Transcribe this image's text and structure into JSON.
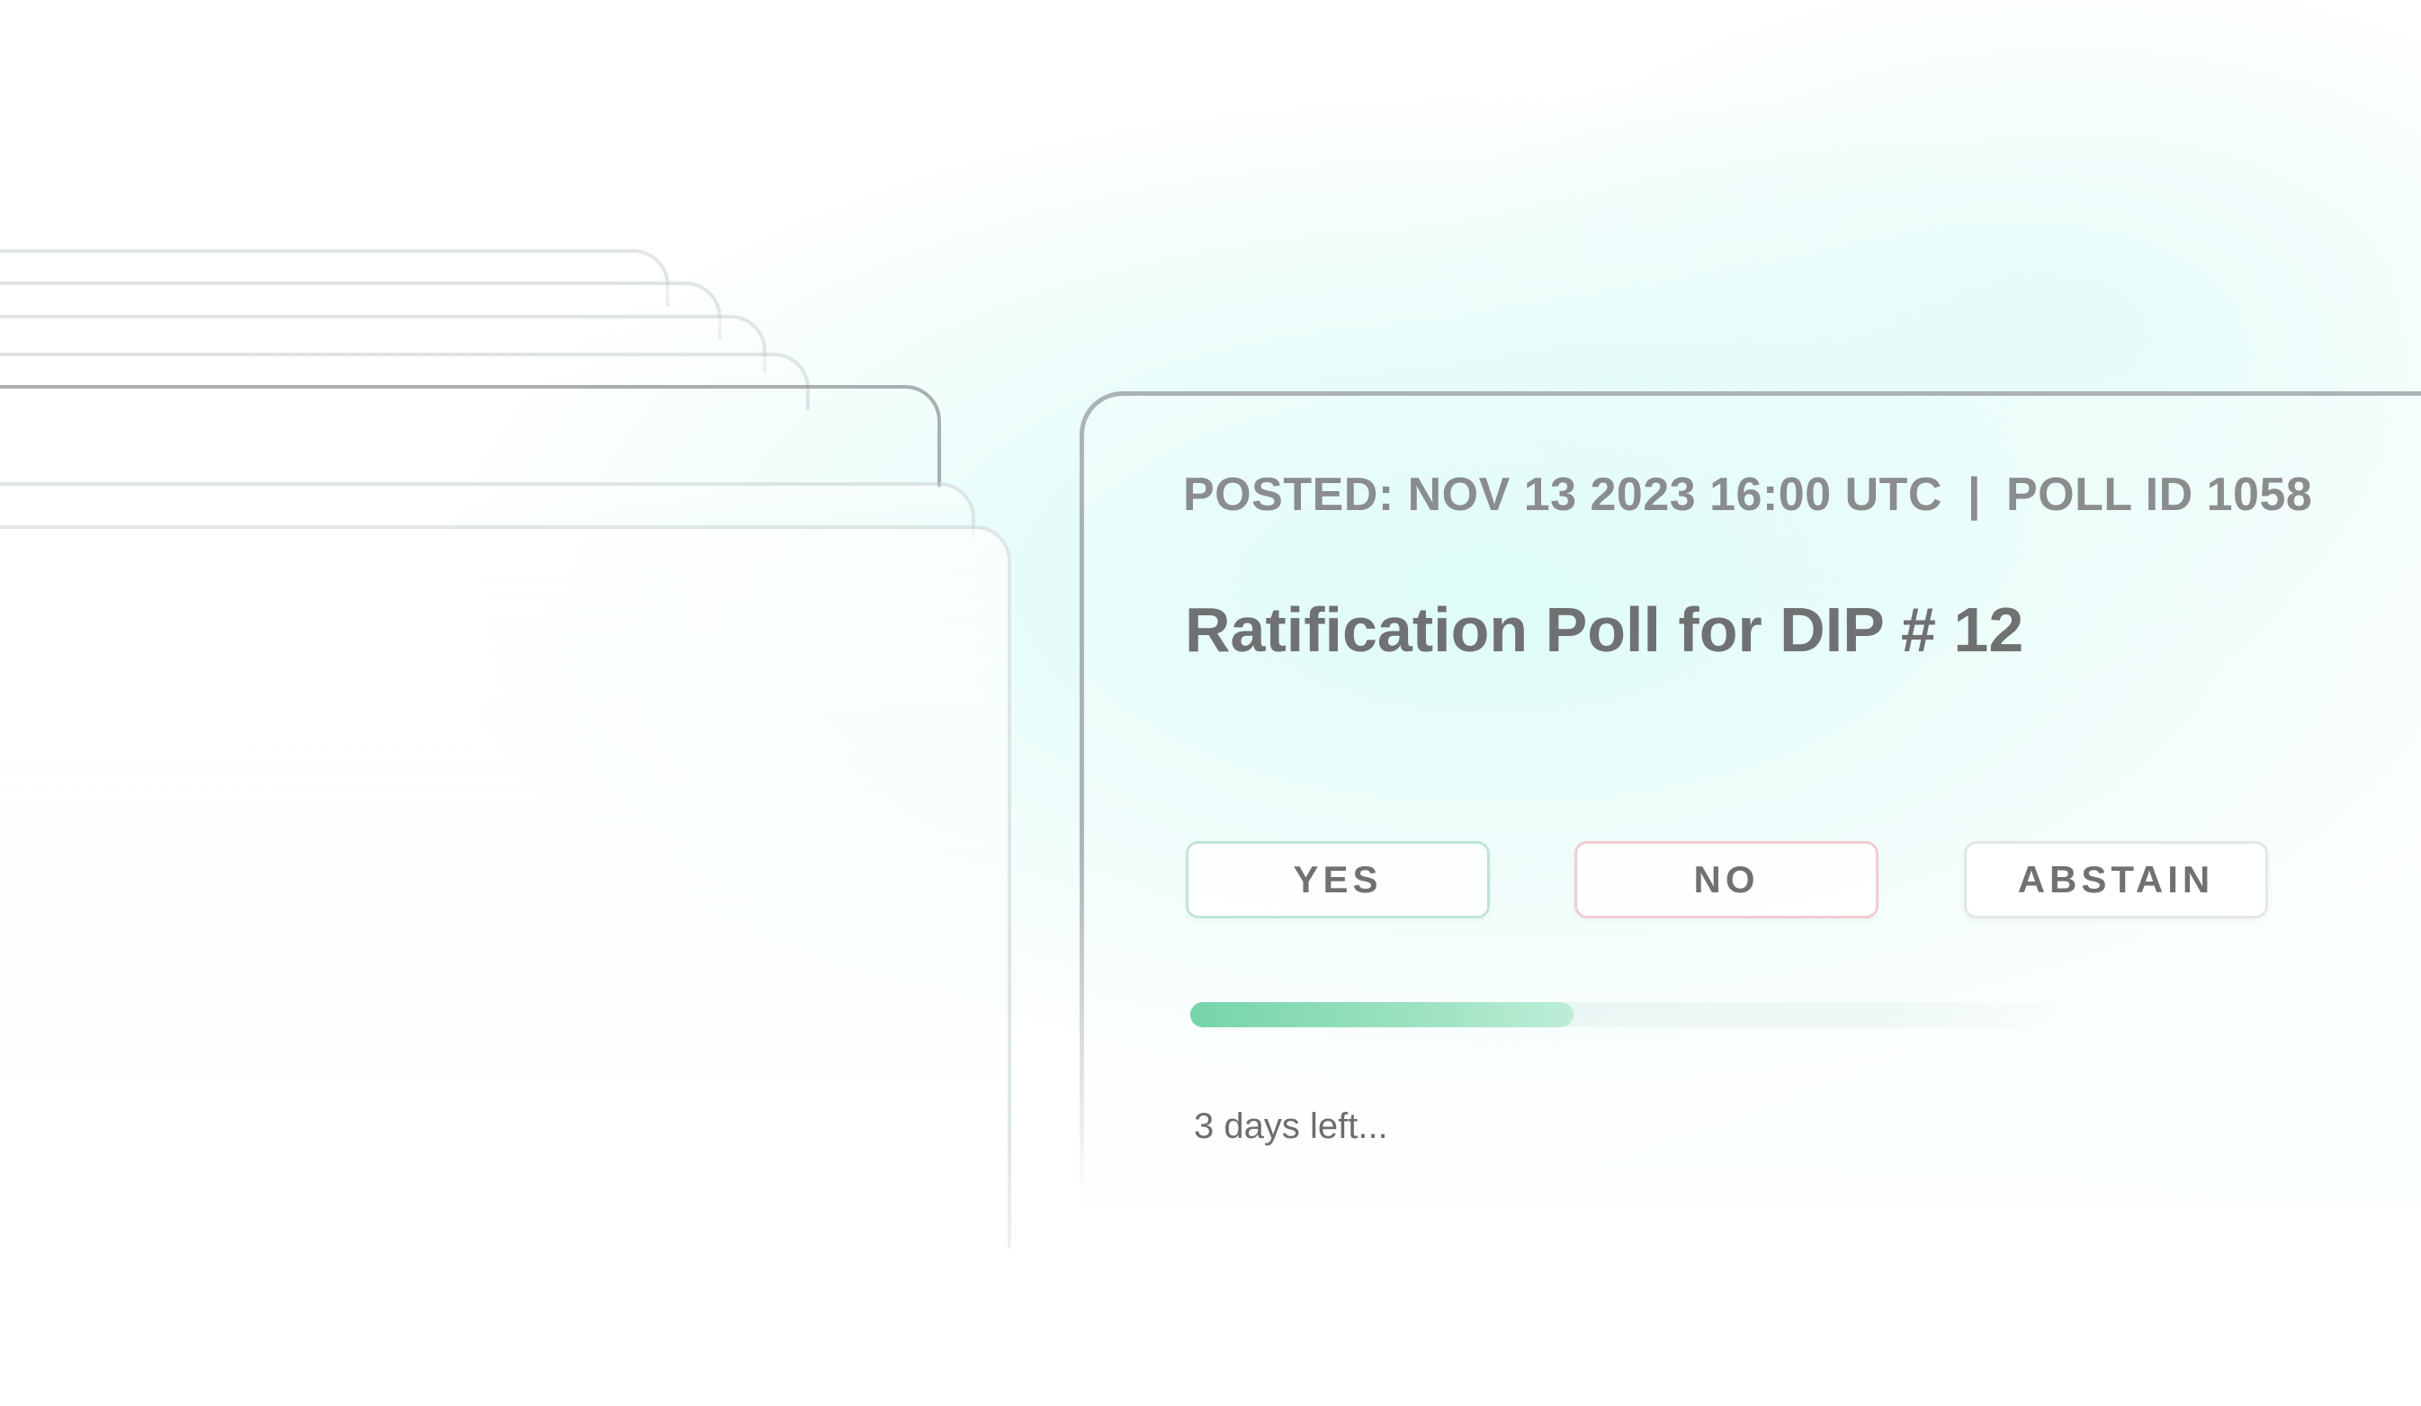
{
  "poll": {
    "posted_label": "POSTED: NOV 13 2023 16:00 UTC",
    "separator": "|",
    "poll_id_label": "POLL ID 1058",
    "title": "Ratification Poll for DIP # 12",
    "options": {
      "yes": "YES",
      "no": "NO",
      "abstain": "ABSTAIN"
    },
    "progress_percent": 43,
    "time_remaining": "3 days left..."
  },
  "colors": {
    "accent_green": "#75d4aa",
    "yes_border": "#bfe6d5",
    "no_border": "#f1cdcf",
    "text_gray": "#6f7173"
  }
}
